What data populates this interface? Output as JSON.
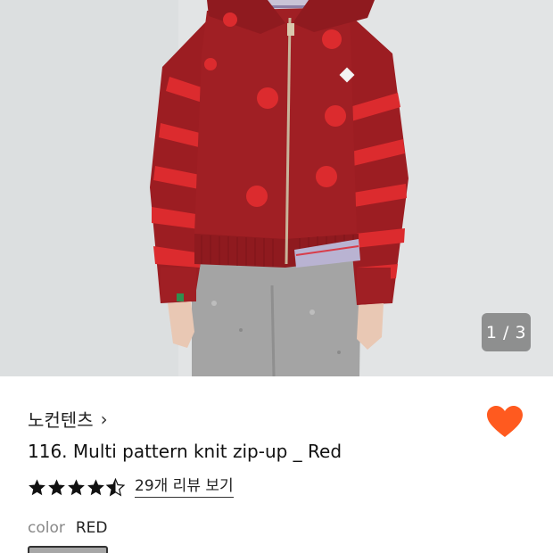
{
  "gallery": {
    "counter": "1 / 3",
    "photo_subject": "red polka-dot striped knit zip-up cardigan"
  },
  "product": {
    "brand": "노컨텐츠",
    "brand_chevron": "›",
    "title": "116. Multi pattern knit zip-up _ Red",
    "rating": 4.5,
    "review_link": "29개 리뷰 보기",
    "wishlist_icon": "heart-icon",
    "colors": {
      "heart": "#ff5a1f",
      "star": "#111111",
      "knit": "#a01f24",
      "accent_red": "#dc2b2e"
    }
  },
  "options": {
    "label": "color",
    "value": "RED"
  }
}
